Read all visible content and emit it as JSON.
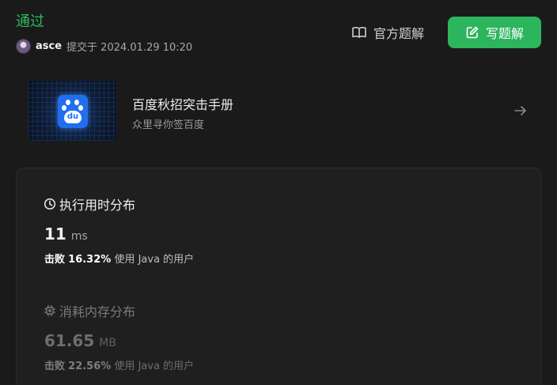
{
  "header": {
    "status": "通过",
    "username": "asce",
    "submitted_text": "提交于 2024.01.29 10:20",
    "official_solution_label": "官方题解",
    "write_solution_label": "写题解"
  },
  "promo": {
    "title": "百度秋招突击手册",
    "subtitle": "众里寻你签百度",
    "logo_text": "du",
    "icon": "baidu-paw-logo"
  },
  "stats": {
    "runtime": {
      "title": "执行用时分布",
      "value": "11",
      "unit": "ms",
      "beat_prefix": "击败",
      "beat_percent": "16.32%",
      "beat_suffix": "使用 Java 的用户"
    },
    "memory": {
      "title": "消耗内存分布",
      "value": "61.65",
      "unit": "MB",
      "beat_prefix": "击败",
      "beat_percent": "22.56%",
      "beat_suffix": "使用 Java 的用户"
    }
  },
  "colors": {
    "accept_green": "#2cbb5d",
    "button_green": "#2db55d",
    "background": "#1a1a1a"
  }
}
